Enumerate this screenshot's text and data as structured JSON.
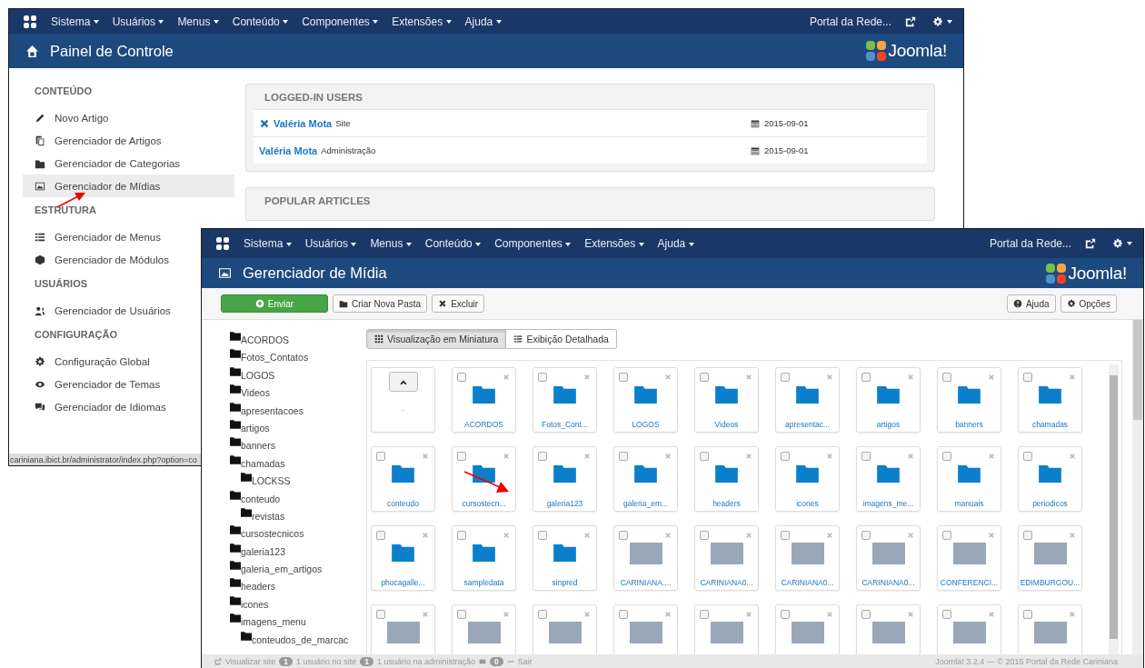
{
  "back_window": {
    "menu": [
      "Sistema",
      "Usuários",
      "Menus",
      "Conteúdo",
      "Componentes",
      "Extensões",
      "Ajuda"
    ],
    "site_link": "Portal da Rede...",
    "title": "Painel de Controle",
    "logo_text": "Joomla!",
    "sidebar": [
      {
        "heading": "CONTEÚDO",
        "items": [
          {
            "label": "Novo Artigo",
            "selected": false
          },
          {
            "label": "Gerenciador de Artigos",
            "selected": false
          },
          {
            "label": "Gerenciador de Categorias",
            "selected": false
          },
          {
            "label": "Gerenciador de Mídias",
            "selected": true
          }
        ]
      },
      {
        "heading": "ESTRUTURA",
        "items": [
          {
            "label": "Gerenciador de Menus",
            "selected": false
          },
          {
            "label": "Gerenciador de Módulos",
            "selected": false
          }
        ]
      },
      {
        "heading": "USUÁRIOS",
        "items": [
          {
            "label": "Gerenciador de Usuários",
            "selected": false
          }
        ]
      },
      {
        "heading": "CONFIGURAÇÃO",
        "items": [
          {
            "label": "Configuração Global",
            "selected": false
          },
          {
            "label": "Gerenciador de Temas",
            "selected": false
          },
          {
            "label": "Gerenciador de Idiomas",
            "selected": false
          }
        ]
      }
    ],
    "logged_in_users": {
      "title": "LOGGED-IN USERS",
      "rows": [
        {
          "name": "Valéria Mota",
          "location": "Site",
          "date": "2015-09-01",
          "logout": true
        },
        {
          "name": "Valéria Mota",
          "location": "Administração",
          "date": "2015-09-01",
          "logout": false
        }
      ]
    },
    "popular_articles": {
      "title": "POPULAR ARTICLES"
    },
    "status_url": "cariniana.ibict.br/administrator/index.php?option=co"
  },
  "front_window": {
    "menu": [
      "Sistema",
      "Usuários",
      "Menus",
      "Conteúdo",
      "Componentes",
      "Extensões",
      "Ajuda"
    ],
    "site_link": "Portal da Rede...",
    "title": "Gerenciador de Mídia",
    "logo_text": "Joomla!",
    "buttons": [
      {
        "label": "Enviar",
        "kind": "primary"
      },
      {
        "label": "Criar Nova Pasta",
        "kind": "default"
      },
      {
        "label": "Excluir",
        "kind": "default"
      }
    ],
    "right_buttons": [
      "Ajuda",
      "Opções"
    ],
    "view_tabs": [
      {
        "label": "Visualização em Miniatura",
        "selected": true
      },
      {
        "label": "Exibição Detalhada",
        "selected": false
      }
    ],
    "folders": [
      {
        "name": "ACORDOS"
      },
      {
        "name": "Fotos_Contatos"
      },
      {
        "name": "LOGOS"
      },
      {
        "name": "Videos"
      },
      {
        "name": "apresentacoes"
      },
      {
        "name": "artigos"
      },
      {
        "name": "banners"
      },
      {
        "name": "chamadas",
        "children": [
          {
            "name": "LOCKSS"
          }
        ]
      },
      {
        "name": "conteudo",
        "children": [
          {
            "name": "revistas"
          }
        ]
      },
      {
        "name": "cursostecnicos"
      },
      {
        "name": "galeria123"
      },
      {
        "name": "galeria_em_artigos"
      },
      {
        "name": "headers"
      },
      {
        "name": "icones"
      },
      {
        "name": "imagens_menu",
        "children": [
          {
            "name": "conteudos_de_marcac"
          }
        ]
      }
    ],
    "items": [
      {
        "kind": "up",
        "name": ".."
      },
      {
        "kind": "folder",
        "name": "ACORDOS",
        "checked": false
      },
      {
        "kind": "folder",
        "name": "Fotos_Cont...",
        "checked": false
      },
      {
        "kind": "folder",
        "name": "LOGOS",
        "checked": false
      },
      {
        "kind": "folder",
        "name": "Videos",
        "checked": false
      },
      {
        "kind": "folder",
        "name": "apresentac...",
        "checked": false
      },
      {
        "kind": "folder",
        "name": "artigos",
        "checked": false
      },
      {
        "kind": "folder",
        "name": "banners",
        "checked": false
      },
      {
        "kind": "folder",
        "name": "chamadas",
        "checked": false
      },
      {
        "kind": "folder",
        "name": "conteudo",
        "checked": false
      },
      {
        "kind": "folder",
        "name": "cursostecn...",
        "checked": false
      },
      {
        "kind": "folder",
        "name": "galeria123",
        "checked": false
      },
      {
        "kind": "folder",
        "name": "galeria_em...",
        "checked": false
      },
      {
        "kind": "folder",
        "name": "headers",
        "checked": false
      },
      {
        "kind": "folder",
        "name": "icones",
        "checked": false
      },
      {
        "kind": "folder",
        "name": "imagens_me...",
        "checked": false
      },
      {
        "kind": "folder",
        "name": "manuais",
        "checked": false
      },
      {
        "kind": "folder",
        "name": "periodicos",
        "checked": false
      },
      {
        "kind": "folder",
        "name": "phocagalle...",
        "checked": false
      },
      {
        "kind": "folder",
        "name": "sampledata",
        "checked": false
      },
      {
        "kind": "folder",
        "name": "sinpred",
        "checked": false
      },
      {
        "kind": "image",
        "name": "CARINIANA....",
        "checked": false
      },
      {
        "kind": "image",
        "name": "CARINIANA0...",
        "checked": false
      },
      {
        "kind": "image",
        "name": "CARINIANA0...",
        "checked": false
      },
      {
        "kind": "image",
        "name": "CARINIANA0...",
        "checked": false
      },
      {
        "kind": "image",
        "name": "CONFERENCI...",
        "checked": false
      },
      {
        "kind": "image",
        "name": "EDIMBURGOU...",
        "checked": false
      },
      {
        "kind": "image",
        "checked": false
      },
      {
        "kind": "image",
        "checked": false
      },
      {
        "kind": "image",
        "checked": false
      },
      {
        "kind": "image",
        "checked": false
      },
      {
        "kind": "image",
        "checked": false
      },
      {
        "kind": "image",
        "checked": false
      },
      {
        "kind": "image",
        "checked": false
      },
      {
        "kind": "image",
        "checked": false
      },
      {
        "kind": "image",
        "checked": false
      }
    ],
    "status": {
      "view_site": "Visualizar site",
      "site_count": "1",
      "site_users": "1 usuário no site",
      "admin_count": "1",
      "admin_users": "1 usuário na administração",
      "messages": "0",
      "logout": "Sair",
      "version": "Joomla! 3.2.4 — © 2015 Portal da Rede Cariniana"
    }
  }
}
